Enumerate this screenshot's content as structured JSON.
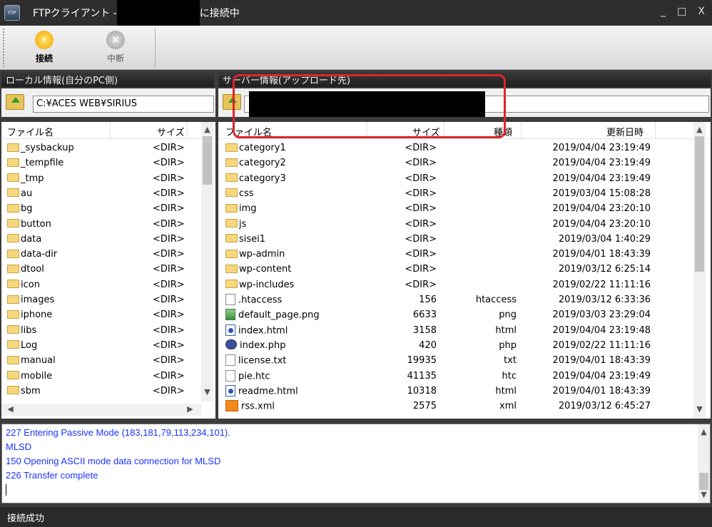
{
  "window": {
    "title_prefix": "FTPクライアント -",
    "title_suffix": "に接続中",
    "minimize": "_",
    "maximize": "□",
    "close": "X"
  },
  "toolbar": {
    "connect_label": "接続",
    "stop_label": "中断"
  },
  "local": {
    "header": "ローカル情報(自分のPC側)",
    "path": "C:¥ACES WEB¥SIRIUS",
    "columns": [
      "ファイル名",
      "サイズ"
    ],
    "files": [
      {
        "name": "_sysbackup",
        "size": "<DIR>"
      },
      {
        "name": "_tempfile",
        "size": "<DIR>"
      },
      {
        "name": "_tmp",
        "size": "<DIR>"
      },
      {
        "name": "au",
        "size": "<DIR>"
      },
      {
        "name": "bg",
        "size": "<DIR>"
      },
      {
        "name": "button",
        "size": "<DIR>"
      },
      {
        "name": "data",
        "size": "<DIR>"
      },
      {
        "name": "data-dir",
        "size": "<DIR>"
      },
      {
        "name": "dtool",
        "size": "<DIR>"
      },
      {
        "name": "icon",
        "size": "<DIR>"
      },
      {
        "name": "images",
        "size": "<DIR>"
      },
      {
        "name": "iphone",
        "size": "<DIR>"
      },
      {
        "name": "libs",
        "size": "<DIR>"
      },
      {
        "name": "Log",
        "size": "<DIR>"
      },
      {
        "name": "manual",
        "size": "<DIR>"
      },
      {
        "name": "mobile",
        "size": "<DIR>"
      },
      {
        "name": "sbm",
        "size": "<DIR>"
      }
    ]
  },
  "remote": {
    "header": "サーバー情報(アップロード先)",
    "columns": [
      "ファイル名",
      "サイズ",
      "種類",
      "更新日時"
    ],
    "files": [
      {
        "name": "category1",
        "size": "<DIR>",
        "type": "",
        "date": "2019/04/04 23:19:49",
        "icon": "folder"
      },
      {
        "name": "category2",
        "size": "<DIR>",
        "type": "",
        "date": "2019/04/04 23:19:49",
        "icon": "folder"
      },
      {
        "name": "category3",
        "size": "<DIR>",
        "type": "",
        "date": "2019/04/04 23:19:49",
        "icon": "folder"
      },
      {
        "name": "css",
        "size": "<DIR>",
        "type": "",
        "date": "2019/03/04 15:08:28",
        "icon": "folder"
      },
      {
        "name": "img",
        "size": "<DIR>",
        "type": "",
        "date": "2019/04/04 23:20:10",
        "icon": "folder"
      },
      {
        "name": "js",
        "size": "<DIR>",
        "type": "",
        "date": "2019/04/04 23:20:10",
        "icon": "folder"
      },
      {
        "name": "sisei1",
        "size": "<DIR>",
        "type": "",
        "date": "2019/03/04 1:40:29",
        "icon": "folder"
      },
      {
        "name": "wp-admin",
        "size": "<DIR>",
        "type": "",
        "date": "2019/04/01 18:43:39",
        "icon": "folder"
      },
      {
        "name": "wp-content",
        "size": "<DIR>",
        "type": "",
        "date": "2019/03/12 6:25:14",
        "icon": "folder"
      },
      {
        "name": "wp-includes",
        "size": "<DIR>",
        "type": "",
        "date": "2019/02/22 11:11:16",
        "icon": "folder"
      },
      {
        "name": ".htaccess",
        "size": "156",
        "type": "htaccess",
        "date": "2019/03/12 6:33:36",
        "icon": "file"
      },
      {
        "name": "default_page.png",
        "size": "6633",
        "type": "png",
        "date": "2019/03/03 23:29:04",
        "icon": "png"
      },
      {
        "name": "index.html",
        "size": "3158",
        "type": "html",
        "date": "2019/04/04 23:19:48",
        "icon": "html"
      },
      {
        "name": "index.php",
        "size": "420",
        "type": "php",
        "date": "2019/02/22 11:11:16",
        "icon": "php"
      },
      {
        "name": "license.txt",
        "size": "19935",
        "type": "txt",
        "date": "2019/04/01 18:43:39",
        "icon": "file"
      },
      {
        "name": "pie.htc",
        "size": "41135",
        "type": "htc",
        "date": "2019/04/04 23:19:49",
        "icon": "file"
      },
      {
        "name": "readme.html",
        "size": "10318",
        "type": "html",
        "date": "2019/04/01 18:43:39",
        "icon": "html"
      },
      {
        "name": "rss.xml",
        "size": "2575",
        "type": "xml",
        "date": "2019/03/12 6:45:27",
        "icon": "xml"
      }
    ]
  },
  "log": [
    "227 Entering Passive Mode (183,181,79,113,234,101).",
    "MLSD",
    "150 Opening ASCII mode data connection for MLSD",
    "226 Transfer complete"
  ],
  "status": "接続成功",
  "colors": {
    "highlight": "#e0242a",
    "log_text": "#1a33ff"
  }
}
